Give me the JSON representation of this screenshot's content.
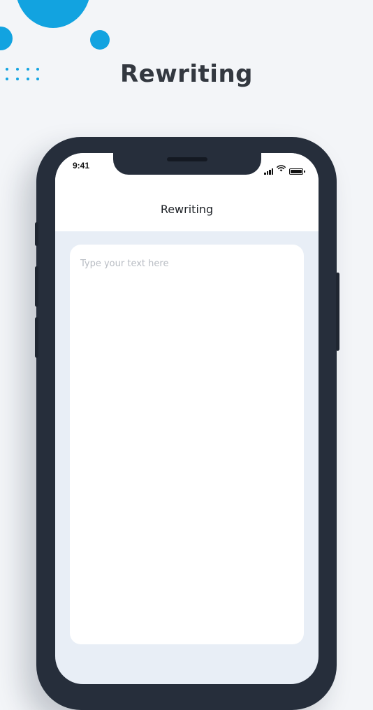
{
  "promo": {
    "headline": "Rewriting",
    "accent_color": "#12a3e0",
    "background_color": "#f3f5f8"
  },
  "device": {
    "frame_color": "#262e3b"
  },
  "status_bar": {
    "time": "9:41",
    "icons": [
      "signal-icon",
      "wifi-icon",
      "battery-icon"
    ]
  },
  "app": {
    "title": "Rewriting",
    "screen_background": "#e8eef6",
    "input": {
      "value": "",
      "placeholder": "Type your text here"
    }
  }
}
